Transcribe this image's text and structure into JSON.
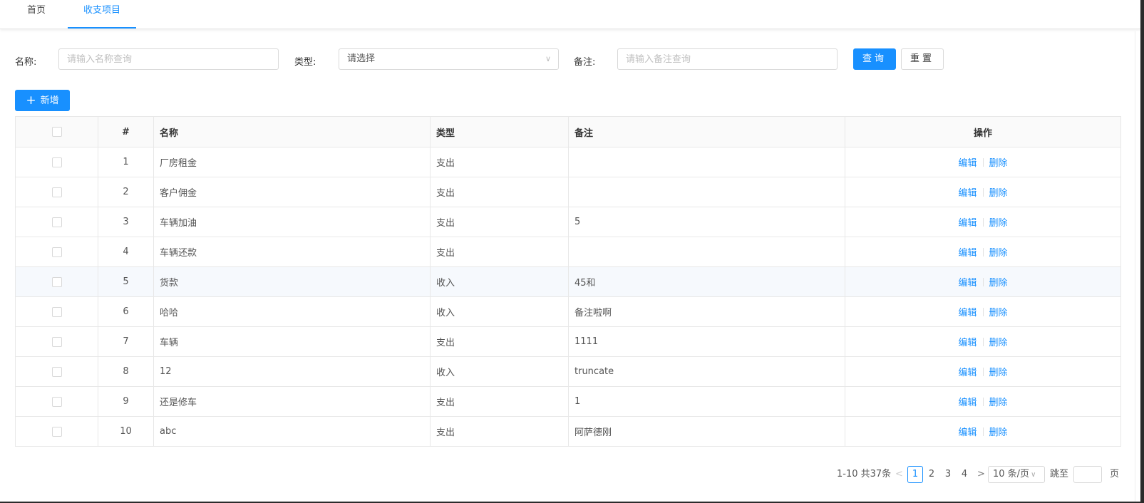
{
  "tabs": [
    {
      "label": "首页",
      "active": false
    },
    {
      "label": "收支项目",
      "active": true
    }
  ],
  "filters": {
    "name_label": "名称:",
    "name_placeholder": "请输入名称查询",
    "type_label": "类型:",
    "type_value": "请选择",
    "note_label": "备注:",
    "note_placeholder": "请输入备注查询",
    "query_button": "查询",
    "reset_button": "重置"
  },
  "add_button": "新增",
  "table": {
    "headers": {
      "index": "#",
      "name": "名称",
      "type": "类型",
      "note": "备注",
      "ops": "操作"
    },
    "rows": [
      {
        "index": "1",
        "name": "厂房租金",
        "type": "支出",
        "note": ""
      },
      {
        "index": "2",
        "name": "客户佣金",
        "type": "支出",
        "note": ""
      },
      {
        "index": "3",
        "name": "车辆加油",
        "type": "支出",
        "note": "5"
      },
      {
        "index": "4",
        "name": "车辆还款",
        "type": "支出",
        "note": ""
      },
      {
        "index": "5",
        "name": "货款",
        "type": "收入",
        "note": "45和"
      },
      {
        "index": "6",
        "name": "哈哈",
        "type": "收入",
        "note": "备注啦啊"
      },
      {
        "index": "7",
        "name": "车辆",
        "type": "支出",
        "note": "1111"
      },
      {
        "index": "8",
        "name": "12",
        "type": "收入",
        "note": "truncate"
      },
      {
        "index": "9",
        "name": "还是修车",
        "type": "支出",
        "note": "1"
      },
      {
        "index": "10",
        "name": "abc",
        "type": "支出",
        "note": "阿萨德刚"
      }
    ],
    "edit_label": "编辑",
    "delete_label": "删除",
    "hover_row": 4
  },
  "pagination": {
    "total_text": "1-10 共37条",
    "pages": [
      "1",
      "2",
      "3",
      "4"
    ],
    "current_page": "1",
    "page_size": "10 条/页",
    "jump_label": "跳至",
    "jump_suffix": "页"
  },
  "colors": {
    "primary": "#1890ff",
    "border": "#e8e8e8",
    "header_bg": "#fafafa"
  }
}
